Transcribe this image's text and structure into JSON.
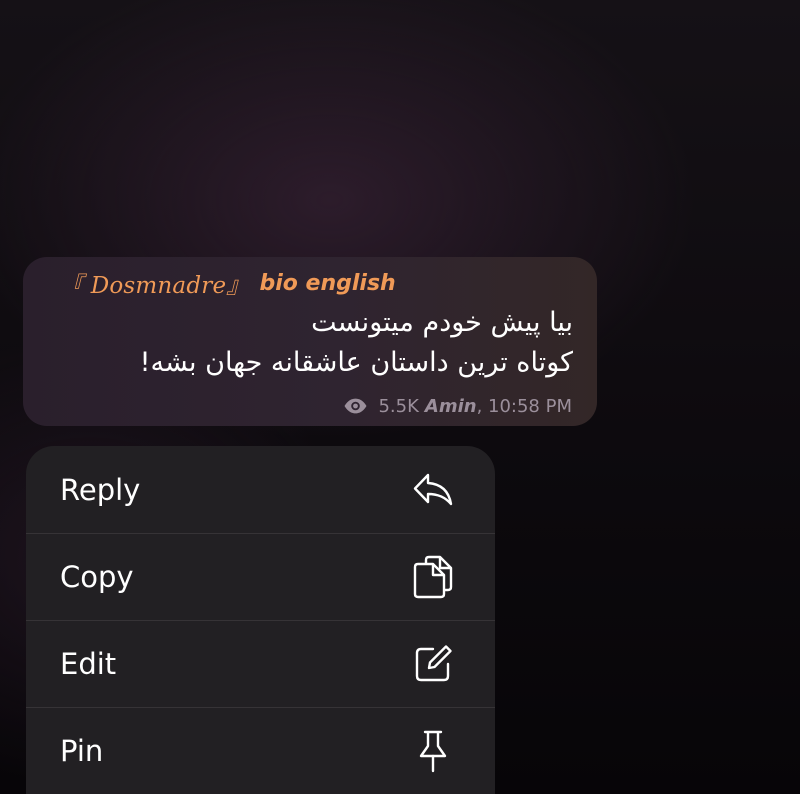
{
  "message": {
    "sender_name": "『 Dosmnadre』",
    "sender_bio": "bio english",
    "text_lines": [
      "بیا پیش خودم میتونست",
      "کوتاه ترین داستان عاشقانه جهان بشه!"
    ],
    "views": "5.5K",
    "author": "Amin",
    "time": ", 10:58 PM",
    "icons": {
      "views": "eye-icon"
    },
    "colors": {
      "sender": "#f09a57",
      "text": "#ffffff",
      "meta": "#9b8f9b"
    }
  },
  "menu": {
    "items": [
      {
        "label": "Reply",
        "icon": "reply-icon"
      },
      {
        "label": "Copy",
        "icon": "copy-icon"
      },
      {
        "label": "Edit",
        "icon": "edit-icon"
      },
      {
        "label": "Pin",
        "icon": "pin-icon"
      }
    ]
  }
}
